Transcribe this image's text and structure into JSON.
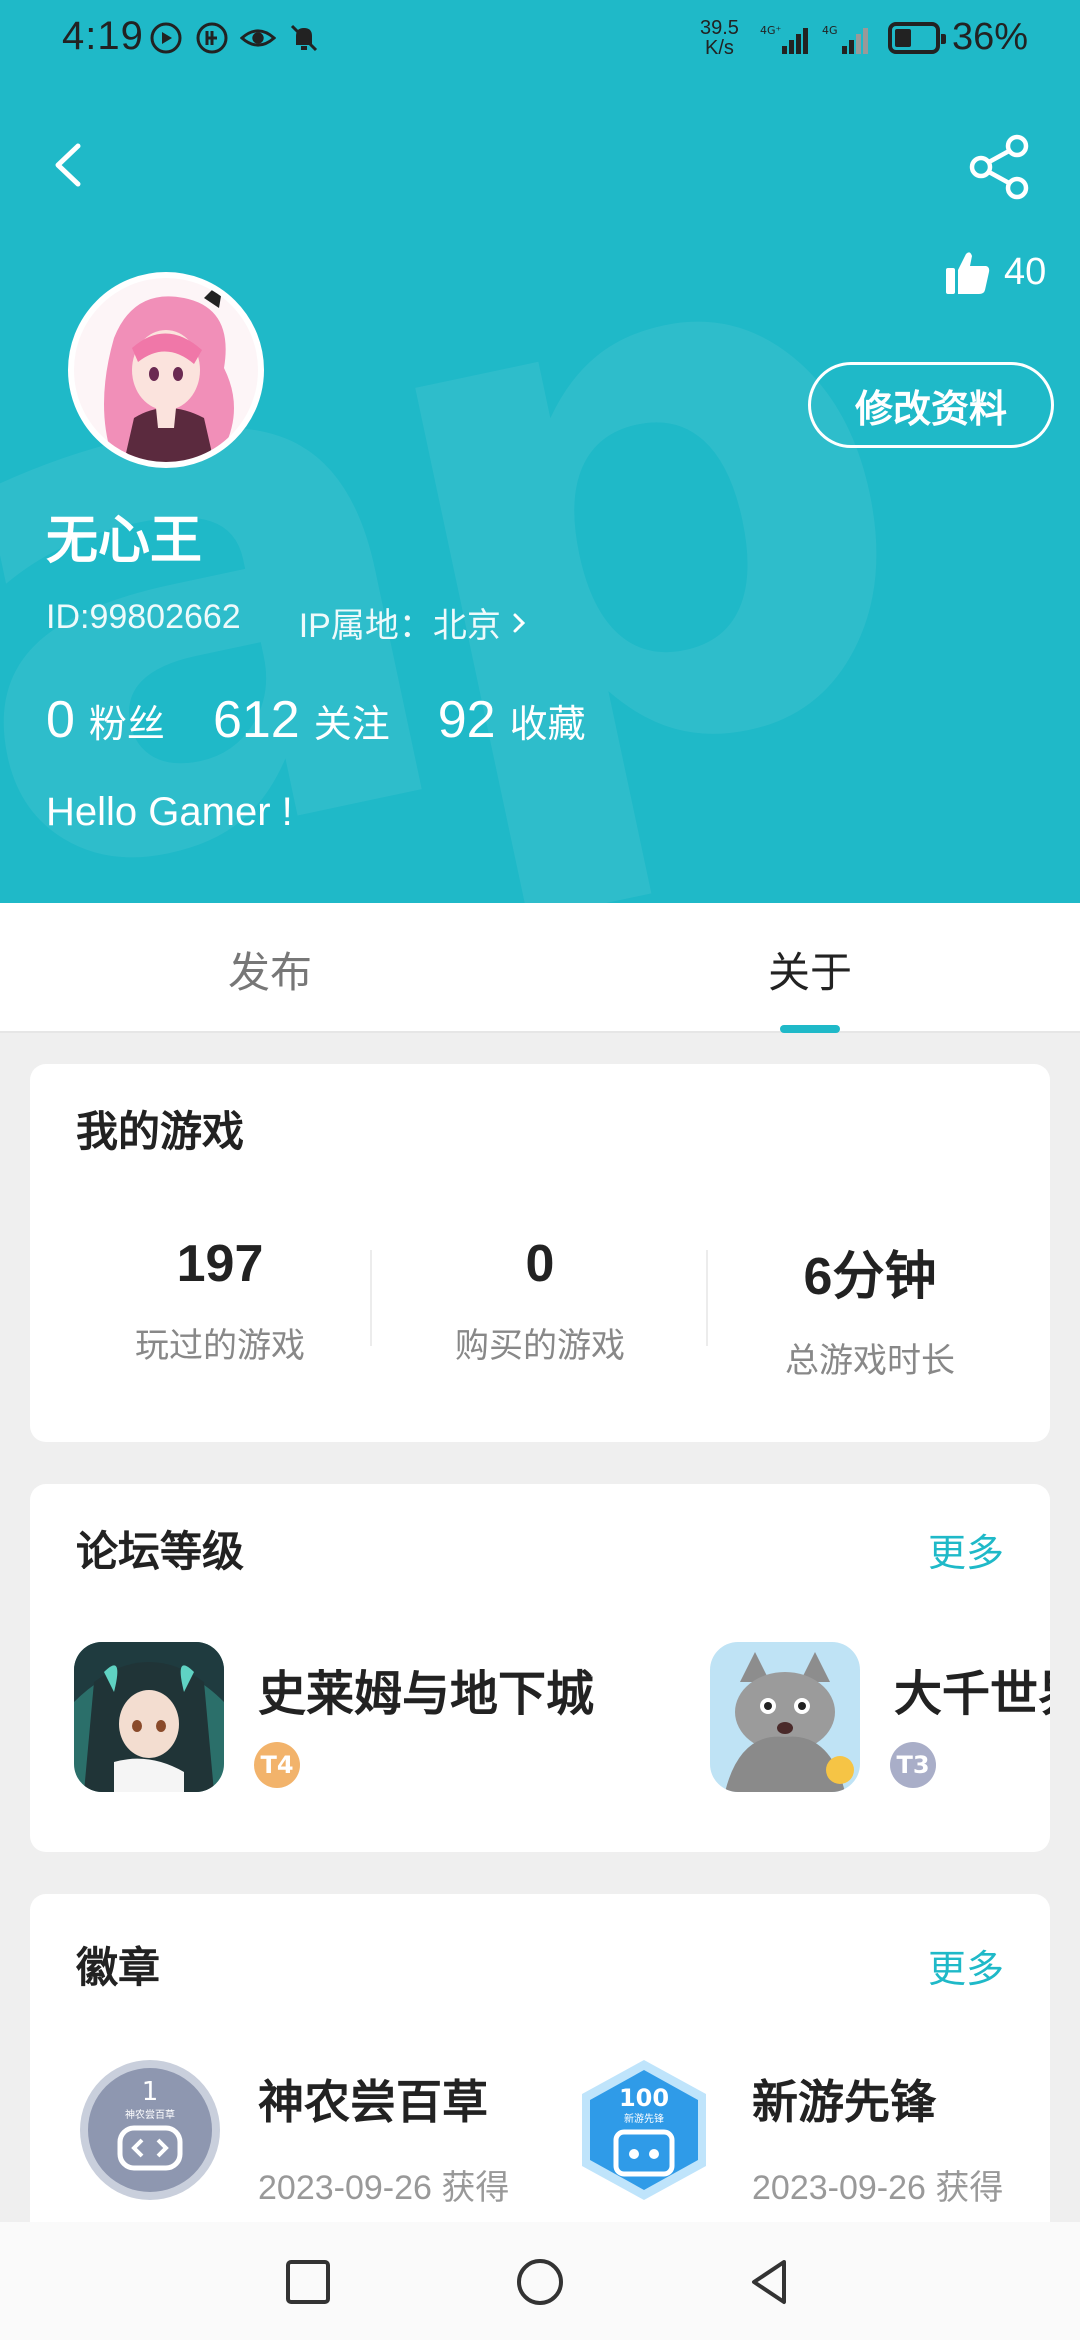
{
  "status_bar": {
    "time": "4:19",
    "net_speed_value": "39.5",
    "net_speed_unit": "K/s",
    "battery_percent": "36%"
  },
  "profile": {
    "likes": "40",
    "edit_label": "修改资料",
    "username": "无心王",
    "id_text": "ID:99802662",
    "ip_text": "IP属地：北京",
    "stats": [
      {
        "value": "0",
        "label": "粉丝"
      },
      {
        "value": "612",
        "label": "关注"
      },
      {
        "value": "92",
        "label": "收藏"
      }
    ],
    "bio": "Hello Gamer !"
  },
  "tabs": {
    "publish": "发布",
    "about": "关于",
    "active": "about"
  },
  "my_games": {
    "title": "我的游戏",
    "stats": [
      {
        "value": "197",
        "label": "玩过的游戏"
      },
      {
        "value": "0",
        "label": "购买的游戏"
      },
      {
        "value": "6分钟",
        "label": "总游戏时长"
      }
    ]
  },
  "forum_level": {
    "title": "论坛等级",
    "more": "更多",
    "items": [
      {
        "name": "史莱姆与地下城",
        "badge": "T4",
        "badge_color": "#f2b36b"
      },
      {
        "name": "大千世界",
        "badge": "T3",
        "badge_color": "#a9aec8"
      }
    ]
  },
  "badges": {
    "title": "徽章",
    "more": "更多",
    "items": [
      {
        "name": "神农尝百草",
        "date": "2023-09-26 获得",
        "icon_number": "1",
        "icon_caption": "神农尝百草"
      },
      {
        "name": "新游先锋",
        "date": "2023-09-26 获得",
        "icon_number": "100",
        "icon_caption": "新游先锋"
      }
    ]
  },
  "colors": {
    "accent": "#1fb9c8",
    "header_bg": "#1fb9c8"
  }
}
